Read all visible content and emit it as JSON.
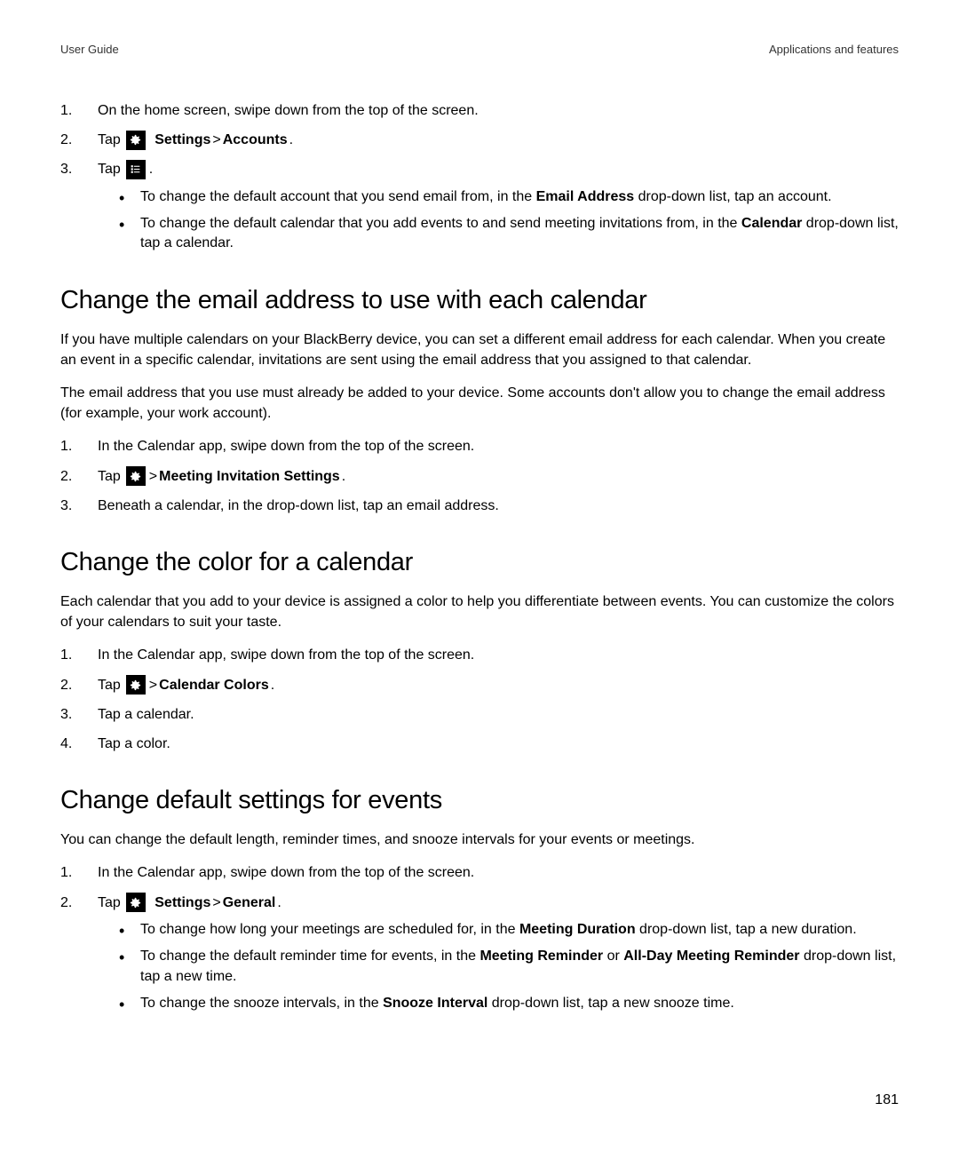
{
  "header": {
    "left": "User Guide",
    "right": "Applications and features"
  },
  "section0": {
    "steps": [
      {
        "num": "1.",
        "text": "On the home screen, swipe down from the top of the screen."
      },
      {
        "num": "2.",
        "prefix": "Tap ",
        "bold1": "Settings",
        "sep": " > ",
        "bold2": "Accounts",
        "suffix": "."
      },
      {
        "num": "3.",
        "prefix": "Tap ",
        "suffix": " ."
      }
    ],
    "bullets": [
      {
        "pre": "To change the default account that you send email from, in the ",
        "b1": "Email Address",
        "post": " drop-down list, tap an account."
      },
      {
        "pre": "To change the default calendar that you add events to and send meeting invitations from, in the ",
        "b1": "Calendar",
        "post": " drop-down list, tap a calendar."
      }
    ]
  },
  "section1": {
    "heading": "Change the email address to use with each calendar",
    "para1": "If you have multiple calendars on your BlackBerry device, you can set a different email address for each calendar. When you create an event in a specific calendar, invitations are sent using the email address that you assigned to that calendar.",
    "para2": "The email address that you use must already be added to your device. Some accounts don't allow you to change the email address (for example, your work account).",
    "steps": [
      {
        "num": "1.",
        "text": "In the Calendar app, swipe down from the top of the screen."
      },
      {
        "num": "2.",
        "prefix": "Tap ",
        "sep": " > ",
        "bold1": "Meeting Invitation Settings",
        "suffix": "."
      },
      {
        "num": "3.",
        "text": "Beneath a calendar, in the drop-down list, tap an email address."
      }
    ]
  },
  "section2": {
    "heading": "Change the color for a calendar",
    "para1": "Each calendar that you add to your device is assigned a color to help you differentiate between events. You can customize the colors of your calendars to suit your taste.",
    "steps": [
      {
        "num": "1.",
        "text": "In the Calendar app, swipe down from the top of the screen."
      },
      {
        "num": "2.",
        "prefix": "Tap ",
        "sep": " > ",
        "bold1": "Calendar Colors",
        "suffix": "."
      },
      {
        "num": "3.",
        "text": "Tap a calendar."
      },
      {
        "num": "4.",
        "text": "Tap a color."
      }
    ]
  },
  "section3": {
    "heading": "Change default settings for events",
    "para1": "You can change the default length, reminder times, and snooze intervals for your events or meetings.",
    "steps": [
      {
        "num": "1.",
        "text": "In the Calendar app, swipe down from the top of the screen."
      },
      {
        "num": "2.",
        "prefix": "Tap ",
        "bold1": "Settings",
        "sep": " > ",
        "bold2": "General",
        "suffix": "."
      }
    ],
    "bullets": [
      {
        "pre": "To change how long your meetings are scheduled for, in the ",
        "b1": "Meeting Duration",
        "post": " drop-down list, tap a new duration."
      },
      {
        "pre": "To change the default reminder time for events, in the ",
        "b1": "Meeting Reminder",
        "mid": " or ",
        "b2": "All-Day Meeting Reminder",
        "post": " drop-down list, tap a new time."
      },
      {
        "pre": "To change the snooze intervals, in the ",
        "b1": "Snooze Interval",
        "post": " drop-down list, tap a new snooze time."
      }
    ]
  },
  "page_number": "181"
}
